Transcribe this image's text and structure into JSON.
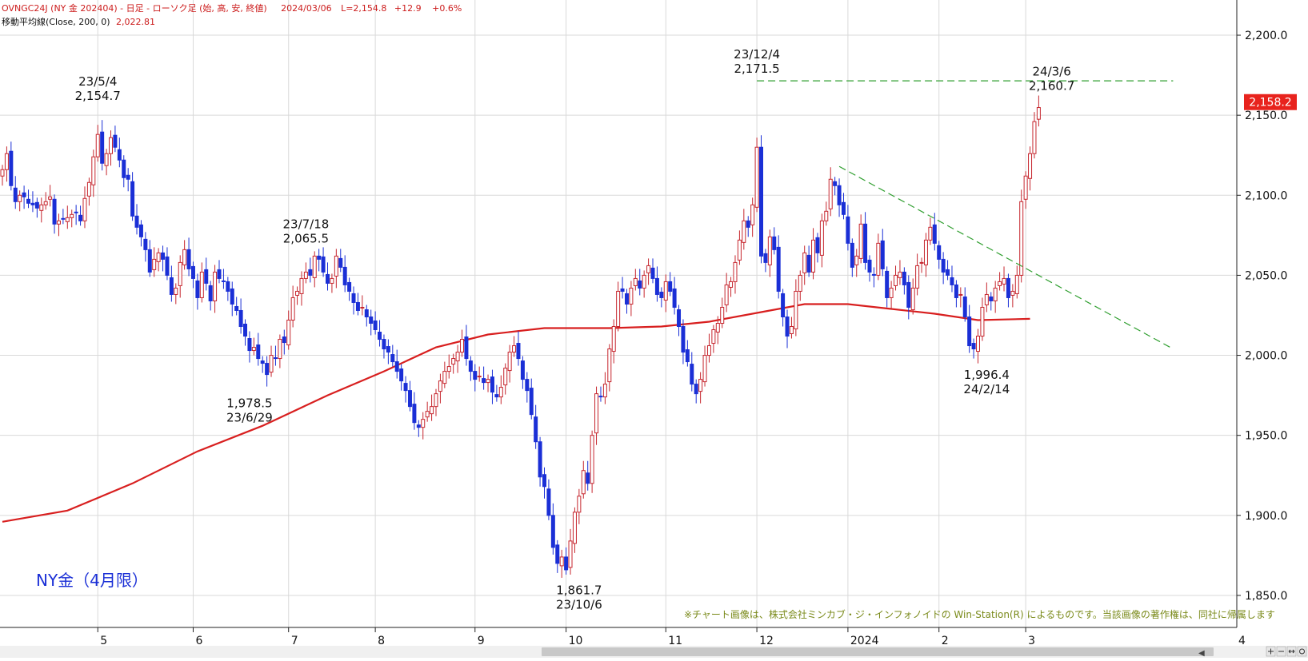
{
  "header": {
    "title": "OVNGC24J (NY 金 202404) - 日足 - ローソク足 (始, 高, 安, 終値)",
    "date": "2024/03/06",
    "last": "L=2,154.8",
    "change": "+12.9",
    "change_pct": "+0.6%",
    "ma_label": "移動平均線(Close, 200, 0)",
    "ma_value": "2,022.81"
  },
  "chart_data": {
    "type": "candlestick",
    "title": "NY金（4月限）",
    "instrument": "NY 金 202404",
    "ylim": [
      1830,
      2212
    ],
    "yticks": [
      {
        "value": 1850,
        "label": "1,850.0"
      },
      {
        "value": 1900,
        "label": "1,900.0"
      },
      {
        "value": 1950,
        "label": "1,950.0"
      },
      {
        "value": 2000,
        "label": "2,000.0"
      },
      {
        "value": 2050,
        "label": "2,050.0"
      },
      {
        "value": 2100,
        "label": "2,100.0"
      },
      {
        "value": 2150,
        "label": "2,150.0"
      },
      {
        "value": 2200,
        "label": "2,200.0"
      }
    ],
    "xticks": [
      {
        "label": "5",
        "bar": 22
      },
      {
        "label": "6",
        "bar": 44
      },
      {
        "label": "7",
        "bar": 66
      },
      {
        "label": "8",
        "bar": 86
      },
      {
        "label": "9",
        "bar": 109
      },
      {
        "label": "10",
        "bar": 130
      },
      {
        "label": "11",
        "bar": 153
      },
      {
        "label": "12",
        "bar": 174
      },
      {
        "label": "2024",
        "bar": 195
      },
      {
        "label": "2",
        "bar": 216
      },
      {
        "label": "3",
        "bar": 236
      }
    ],
    "axis_end_label": "4",
    "last_price_label": {
      "value": 2158.2,
      "label": "2,158.2",
      "color": "#e8231d"
    },
    "colors": {
      "up": "#c6262e",
      "down": "#1a2fd6",
      "ma": "#d81f1f",
      "trend": "#2e9e2e",
      "grid": "#d9d9d9"
    },
    "bars_close": [
      2116,
      2126,
      2106,
      2096,
      2100,
      2099,
      2095,
      2094,
      2092,
      2094,
      2096,
      2099,
      2082,
      2084,
      2085,
      2086,
      2088,
      2089,
      2084,
      2098,
      2108,
      2124,
      2138,
      2120,
      2126,
      2136,
      2130,
      2122,
      2111,
      2110,
      2087,
      2080,
      2074,
      2066,
      2052,
      2060,
      2064,
      2060,
      2050,
      2038,
      2042,
      2058,
      2066,
      2054,
      2048,
      2036,
      2052,
      2045,
      2034,
      2052,
      2048,
      2046,
      2040,
      2032,
      2028,
      2018,
      2012,
      2003,
      2005,
      1998,
      1995,
      1988,
      2000,
      1998,
      2010,
      2008,
      2022,
      2036,
      2040,
      2048,
      2052,
      2050,
      2062,
      2060,
      2052,
      2045,
      2048,
      2062,
      2055,
      2044,
      2040,
      2033,
      2028,
      2030,
      2024,
      2020,
      2016,
      2010,
      2004,
      2002,
      1996,
      1990,
      1984,
      1978,
      1968,
      1958,
      1955,
      1960,
      1965,
      1968,
      1976,
      1984,
      1990,
      1993,
      1998,
      2002,
      2010,
      1998,
      1990,
      1985,
      1987,
      1983,
      1985,
      1977,
      1974,
      1980,
      1992,
      2002,
      2006,
      1998,
      1985,
      1978,
      1963,
      1946,
      1924,
      1918,
      1900,
      1880,
      1870,
      1874,
      1866,
      1884,
      1902,
      1912,
      1928,
      1920,
      1950,
      1976,
      1974,
      1982,
      2004,
      2018,
      2040,
      2040,
      2032,
      2042,
      2048,
      2042,
      2050,
      2056,
      2048,
      2038,
      2036,
      2046,
      2040,
      2030,
      2018,
      2002,
      1996,
      1982,
      1976,
      1985,
      2000,
      2006,
      2016,
      2020,
      2030,
      2044,
      2046,
      2058,
      2072,
      2084,
      2080,
      2094,
      2130,
      2062,
      2058,
      2074,
      2066,
      2040,
      2024,
      2012,
      2018,
      2040,
      2050,
      2064,
      2052,
      2072,
      2064,
      2084,
      2090,
      2110,
      2106,
      2094,
      2088,
      2070,
      2055,
      2062,
      2082,
      2058,
      2052,
      2050,
      2070,
      2054,
      2036,
      2042,
      2050,
      2052,
      2044,
      2030,
      2042,
      2056,
      2058,
      2072,
      2080,
      2070,
      2060,
      2052,
      2050,
      2044,
      2036,
      2038,
      2024,
      2006,
      2004,
      2012,
      2030,
      2038,
      2034,
      2042,
      2046,
      2048,
      2036,
      2040,
      2050,
      2096,
      2112,
      2126,
      2146,
      2154.8
    ],
    "moving_average": {
      "label": "移動平均線(Close, 200, 0)",
      "period": 200,
      "points": [
        [
          0,
          1896
        ],
        [
          15,
          1903
        ],
        [
          30,
          1920
        ],
        [
          45,
          1940
        ],
        [
          60,
          1956
        ],
        [
          75,
          1975
        ],
        [
          88,
          1990
        ],
        [
          100,
          2005
        ],
        [
          112,
          2013
        ],
        [
          125,
          2017
        ],
        [
          140,
          2017
        ],
        [
          152,
          2018
        ],
        [
          163,
          2021
        ],
        [
          175,
          2027
        ],
        [
          185,
          2032
        ],
        [
          195,
          2032
        ],
        [
          205,
          2029
        ],
        [
          215,
          2026
        ],
        [
          225,
          2022
        ],
        [
          237,
          2022.81
        ]
      ]
    },
    "annotations": [
      {
        "bar": 22,
        "value": 2154.7,
        "date": "23/5/4",
        "price": "2,154.7",
        "placement": "above"
      },
      {
        "bar": 57,
        "value": 1978.5,
        "date": "23/6/29",
        "price": "1,978.5",
        "placement": "below"
      },
      {
        "bar": 70,
        "value": 2065.5,
        "date": "23/7/18",
        "price": "2,065.5",
        "placement": "above"
      },
      {
        "bar": 133,
        "value": 1861.7,
        "date": "23/10/6",
        "price": "1,861.7",
        "placement": "below"
      },
      {
        "bar": 174,
        "value": 2171.5,
        "date": "23/12/4",
        "price": "2,171.5",
        "placement": "above"
      },
      {
        "bar": 227,
        "value": 1996.4,
        "date": "24/2/14",
        "price": "1,996.4",
        "placement": "below"
      },
      {
        "bar": 242,
        "value": 2160.7,
        "date": "24/3/6",
        "price": "2,160.7",
        "placement": "above"
      }
    ],
    "trendlines": [
      {
        "name": "resistance-horizontal",
        "from": {
          "bar": 174,
          "value": 2171.5
        },
        "to": {
          "bar": 270,
          "value": 2171.5
        }
      },
      {
        "name": "descending-trendline",
        "from": {
          "bar": 193,
          "value": 2118
        },
        "to": {
          "bar": 270,
          "value": 2004
        }
      }
    ]
  },
  "footer": {
    "copyright": "※チャート画像は、株式会社ミンカブ・ジ・インフォノイドの Win-Station(R) によるものです。当該画像の著作権は、同社に帰属します"
  },
  "scrollbar": {
    "left_arrow": "◀",
    "right_arrow": "▶",
    "zoom_icons": [
      "zoom-in-icon",
      "zoom-out-icon",
      "fit-icon",
      "settings-icon"
    ]
  }
}
